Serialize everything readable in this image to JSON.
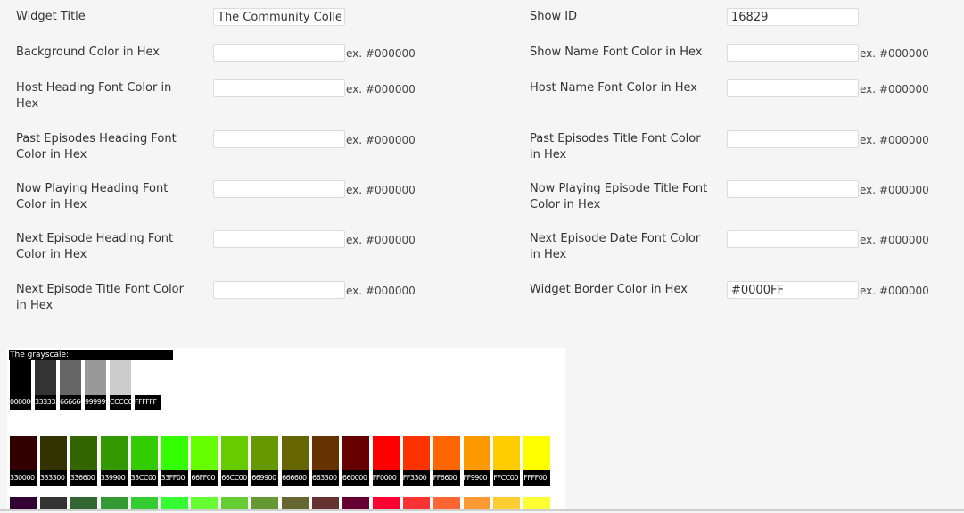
{
  "form": {
    "left": [
      {
        "id": "widget-title",
        "label": "Widget Title",
        "value": "The Community Collec",
        "hint": ""
      },
      {
        "id": "background-color",
        "label": "Background Color in Hex",
        "value": "",
        "hint": "ex. #000000"
      },
      {
        "id": "host-heading-font-color",
        "label": "Host Heading Font Color in Hex",
        "value": "",
        "hint": "ex. #000000"
      },
      {
        "id": "past-episodes-heading-font-color",
        "label": "Past Episodes Heading Font Color in Hex",
        "value": "",
        "hint": "ex. #000000"
      },
      {
        "id": "now-playing-heading-font-color",
        "label": "Now Playing Heading Font Color in Hex",
        "value": "",
        "hint": "ex. #000000"
      },
      {
        "id": "next-episode-heading-font-color",
        "label": "Next Episode Heading Font Color in Hex",
        "value": "",
        "hint": "ex. #000000"
      },
      {
        "id": "next-episode-title-font-color",
        "label": "Next Episode Title Font Color in Hex",
        "value": "",
        "hint": "ex. #000000"
      }
    ],
    "right": [
      {
        "id": "show-id",
        "label": "Show ID",
        "value": "16829",
        "hint": ""
      },
      {
        "id": "show-name-font-color",
        "label": "Show Name Font Color in Hex",
        "value": "",
        "hint": "ex. #000000"
      },
      {
        "id": "host-name-font-color",
        "label": "Host Name Font Color in Hex",
        "value": "",
        "hint": "ex. #000000"
      },
      {
        "id": "past-episodes-title-font-color",
        "label": "Past Episodes Title Font Color in Hex",
        "value": "",
        "hint": "ex. #000000"
      },
      {
        "id": "now-playing-episode-title-font-color",
        "label": "Now Playing Episode Title Font Color in Hex",
        "value": "",
        "hint": "ex. #000000"
      },
      {
        "id": "next-episode-date-font-color",
        "label": "Next Episode Date Font Color in Hex",
        "value": "",
        "hint": "ex. #000000"
      },
      {
        "id": "widget-border-color",
        "label": "Widget Border Color in Hex",
        "value": "#0000FF",
        "hint": "ex. #000000"
      }
    ]
  },
  "palette": {
    "grayscale_title": "The grayscale:",
    "grayscale": [
      {
        "label": "000000",
        "color": "#000000"
      },
      {
        "label": "333333",
        "color": "#333333"
      },
      {
        "label": "666666",
        "color": "#666666"
      },
      {
        "label": "999999",
        "color": "#999999"
      },
      {
        "label": "CCCCCC",
        "color": "#CCCCCC"
      },
      {
        "label": "FFFFFF",
        "color": "#FFFFFF"
      }
    ],
    "row1": [
      {
        "label": "330000",
        "color": "#330000"
      },
      {
        "label": "333300",
        "color": "#333300"
      },
      {
        "label": "336600",
        "color": "#336600"
      },
      {
        "label": "339900",
        "color": "#339900"
      },
      {
        "label": "33CC00",
        "color": "#33CC00"
      },
      {
        "label": "33FF00",
        "color": "#33FF00"
      },
      {
        "label": "66FF00",
        "color": "#66FF00"
      },
      {
        "label": "66CC00",
        "color": "#66CC00"
      },
      {
        "label": "669900",
        "color": "#669900"
      },
      {
        "label": "666600",
        "color": "#666600"
      },
      {
        "label": "663300",
        "color": "#663300"
      },
      {
        "label": "660000",
        "color": "#660000"
      },
      {
        "label": "FF0000",
        "color": "#FF0000"
      },
      {
        "label": "FF3300",
        "color": "#FF3300"
      },
      {
        "label": "FF6600",
        "color": "#FF6600"
      },
      {
        "label": "FF9900",
        "color": "#FF9900"
      },
      {
        "label": "FFCC00",
        "color": "#FFCC00"
      },
      {
        "label": "FFFF00",
        "color": "#FFFF00"
      }
    ],
    "row2": [
      {
        "color": "#330033"
      },
      {
        "color": "#333333"
      },
      {
        "color": "#336633"
      },
      {
        "color": "#339933"
      },
      {
        "color": "#33CC33"
      },
      {
        "color": "#33FF33"
      },
      {
        "color": "#66FF33"
      },
      {
        "color": "#66CC33"
      },
      {
        "color": "#669933"
      },
      {
        "color": "#666633"
      },
      {
        "color": "#663333"
      },
      {
        "color": "#660033"
      },
      {
        "color": "#FF0033"
      },
      {
        "color": "#FF3333"
      },
      {
        "color": "#FF6633"
      },
      {
        "color": "#FF9933"
      },
      {
        "color": "#FFCC33"
      },
      {
        "color": "#FFFF33"
      }
    ]
  }
}
